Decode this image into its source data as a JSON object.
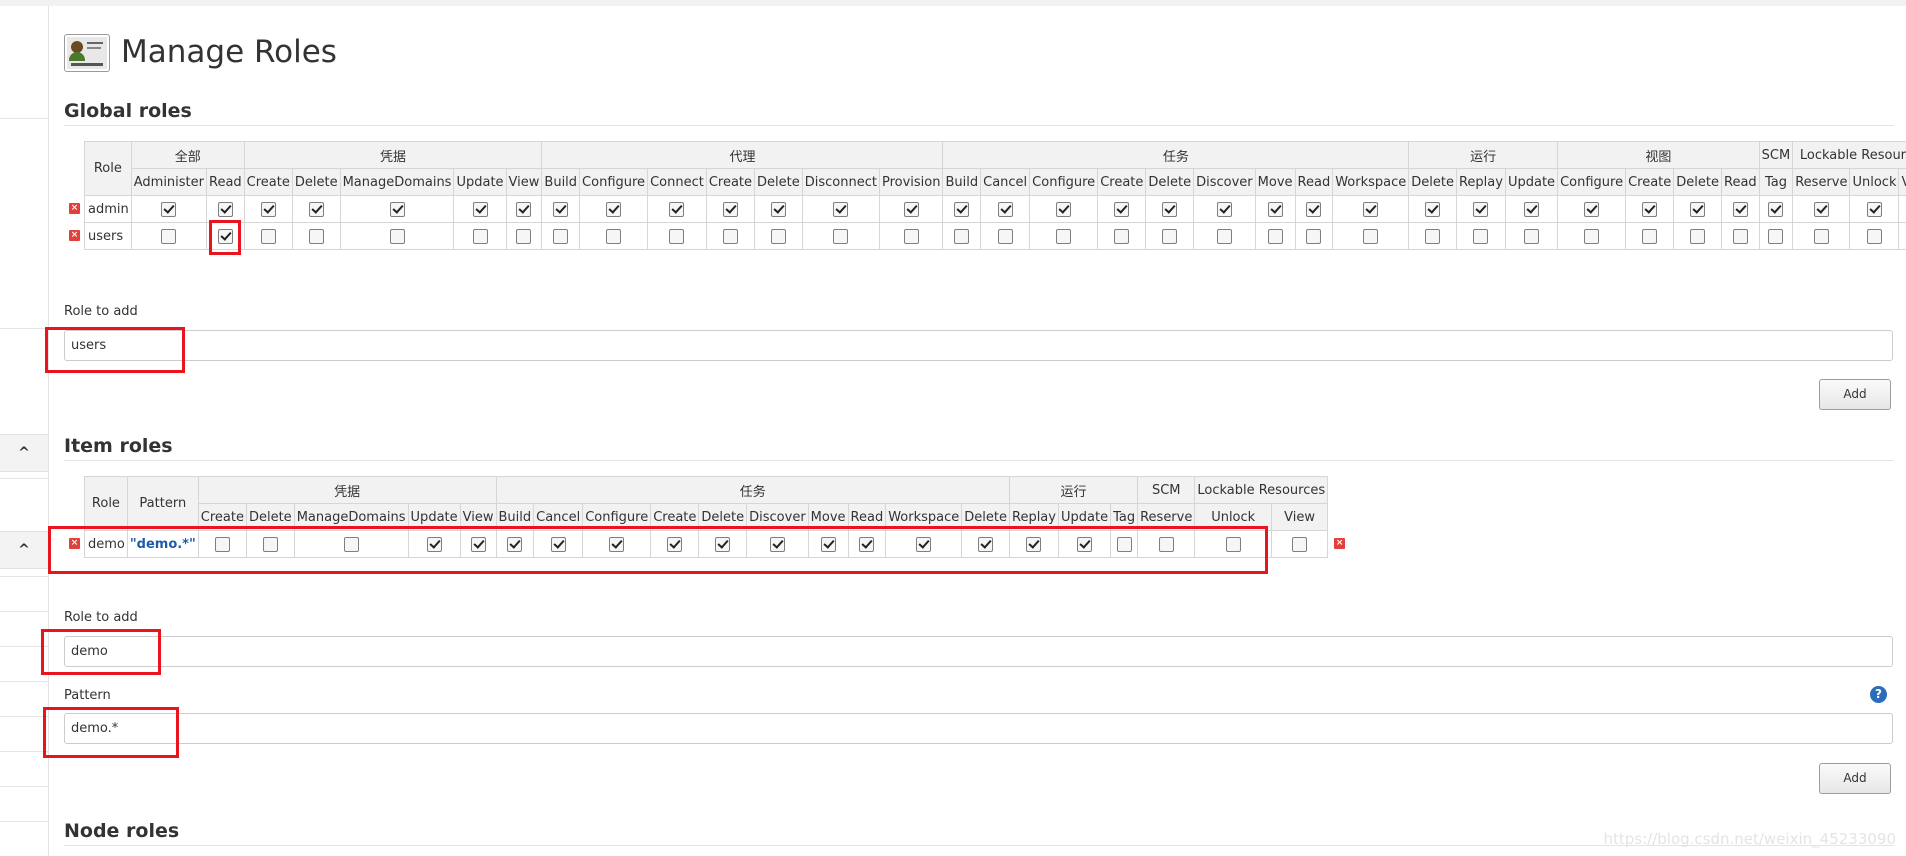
{
  "page": {
    "title": "Manage Roles"
  },
  "global_roles": {
    "heading": "Global roles",
    "groups": [
      {
        "label": "全部",
        "span": 2
      },
      {
        "label": "凭据",
        "span": 5
      },
      {
        "label": "代理",
        "span": 7
      },
      {
        "label": "任务",
        "span": 9
      },
      {
        "label": "运行",
        "span": 3
      },
      {
        "label": "视图",
        "span": 4
      },
      {
        "label": "SCM",
        "span": 1
      },
      {
        "label": "Lockable Resources",
        "span": 3
      }
    ],
    "role_header": "Role",
    "permissions": [
      "Administer",
      "Read",
      "Create",
      "Delete",
      "ManageDomains",
      "Update",
      "View",
      "Build",
      "Configure",
      "Connect",
      "Create",
      "Delete",
      "Disconnect",
      "Provision",
      "Build",
      "Cancel",
      "Configure",
      "Create",
      "Delete",
      "Discover",
      "Move",
      "Read",
      "Workspace",
      "Delete",
      "Replay",
      "Update",
      "Configure",
      "Create",
      "Delete",
      "Read",
      "Tag",
      "Reserve",
      "Unlock",
      "View"
    ],
    "rows": [
      {
        "name": "admin",
        "checks": [
          true,
          true,
          true,
          true,
          true,
          true,
          true,
          true,
          true,
          true,
          true,
          true,
          true,
          true,
          true,
          true,
          true,
          true,
          true,
          true,
          true,
          true,
          true,
          true,
          true,
          true,
          true,
          true,
          true,
          true,
          true,
          true,
          true,
          true
        ]
      },
      {
        "name": "users",
        "checks": [
          false,
          true,
          false,
          false,
          false,
          false,
          false,
          false,
          false,
          false,
          false,
          false,
          false,
          false,
          false,
          false,
          false,
          false,
          false,
          false,
          false,
          false,
          false,
          false,
          false,
          false,
          false,
          false,
          false,
          false,
          false,
          false,
          false,
          false
        ]
      }
    ],
    "role_to_add_label": "Role to add",
    "role_to_add_value": "users",
    "add_label": "Add"
  },
  "item_roles": {
    "heading": "Item roles",
    "groups": [
      {
        "label": "凭据",
        "span": 5
      },
      {
        "label": "任务",
        "span": 10
      },
      {
        "label": "运行",
        "span": 3
      },
      {
        "label": "SCM",
        "span": 1
      },
      {
        "label": "Lockable Resources",
        "span": 3
      }
    ],
    "role_header": "Role",
    "pattern_header": "Pattern",
    "permissions": [
      "Create",
      "Delete",
      "ManageDomains",
      "Update",
      "View",
      "Build",
      "Cancel",
      "Configure",
      "Create",
      "Delete",
      "Discover",
      "Move",
      "Read",
      "Workspace",
      "Delete",
      "Replay",
      "Update",
      "Tag",
      "Reserve",
      "Unlock",
      "View"
    ],
    "rows": [
      {
        "name": "demo",
        "pattern": "\"demo.*\"",
        "checks": [
          false,
          false,
          false,
          true,
          true,
          true,
          true,
          true,
          true,
          true,
          true,
          true,
          true,
          true,
          true,
          true,
          true,
          false,
          false,
          false,
          false
        ]
      }
    ],
    "role_to_add_label": "Role to add",
    "role_to_add_value": "demo",
    "pattern_label": "Pattern",
    "pattern_value": "demo.*",
    "add_label": "Add"
  },
  "node_roles": {
    "heading": "Node roles"
  },
  "watermark": "https://blog.csdn.net/weixin_45233090",
  "colors": {
    "highlight": "#e8141e",
    "delete": "#e0413b",
    "pattern": "#1f5ca8"
  }
}
